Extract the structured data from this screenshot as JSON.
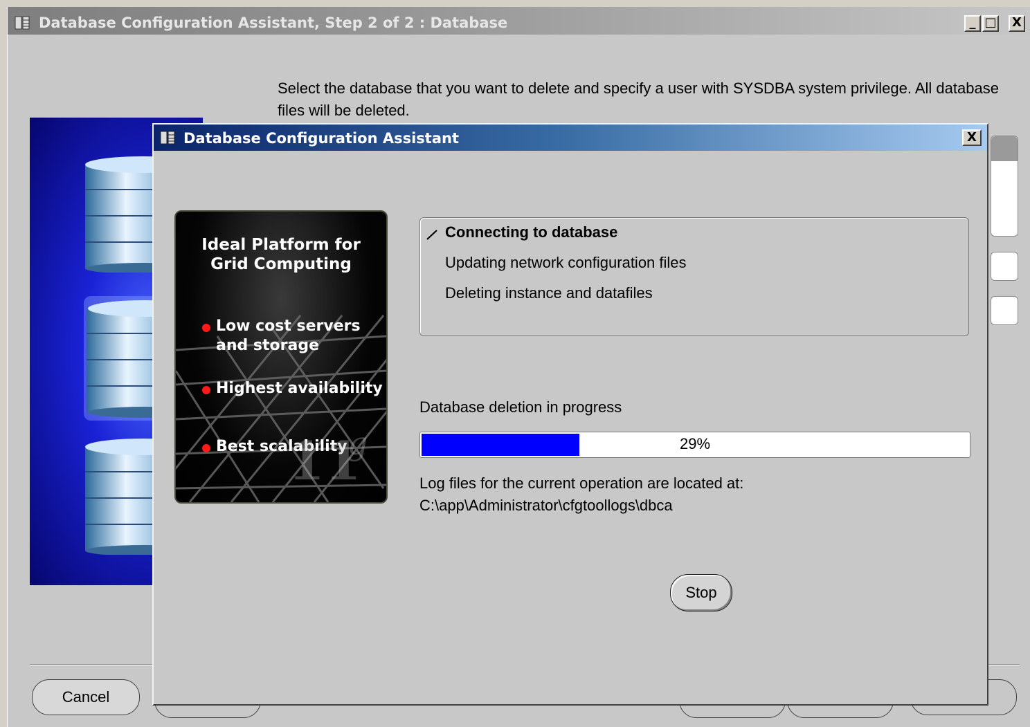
{
  "outer_window": {
    "title": "Database Configuration Assistant, Step 2 of 2 : Database",
    "minimize_label": "_",
    "maximize_label": "□",
    "close_label": "X",
    "instruction": "Select the database that you want to delete and specify a user with SYSDBA system privilege. All database files will be deleted.",
    "cancel_label": "Cancel"
  },
  "dialog": {
    "title": "Database Configuration Assistant",
    "close_label": "X",
    "promo": {
      "heading_line1": "Ideal Platform for",
      "heading_line2": "Grid Computing",
      "bullet1_line1": "Low cost servers",
      "bullet1_line2": "and storage",
      "bullet2": "Highest availability",
      "bullet3": "Best scalability",
      "logo_number": "11",
      "logo_letter": "g"
    },
    "steps": [
      {
        "label": "Connecting to database",
        "state": "in-progress"
      },
      {
        "label": "Updating network configuration files",
        "state": "pending"
      },
      {
        "label": "Deleting instance and datafiles",
        "state": "pending"
      }
    ],
    "progress": {
      "label": "Database deletion in progress",
      "value_percent": 29,
      "text": "29%",
      "fill_color": "#0000ff"
    },
    "log": {
      "label": "Log files for the current operation are located at:",
      "path": "C:\\app\\Administrator\\cfgtoollogs\\dbca"
    },
    "stop_label": "Stop"
  },
  "colors": {
    "dialog_title_start": "#0a246a",
    "dialog_title_end": "#a6caf0",
    "inactive_title": "#8a8a8a",
    "wizard_image_blue": "#1a22d6",
    "promo_bullet": "#ff1a1a"
  }
}
